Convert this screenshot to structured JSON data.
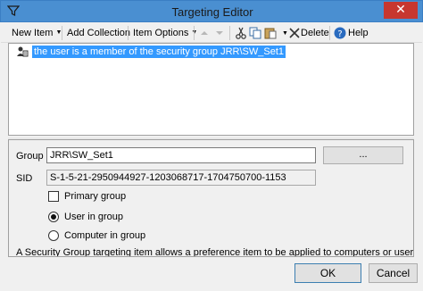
{
  "window": {
    "title": "Targeting Editor",
    "close_glyph": "✕",
    "icon": "filter-icon"
  },
  "toolbar": {
    "new_item": "New Item",
    "add_collection": "Add Collection",
    "item_options": "Item Options",
    "delete": "Delete",
    "help": "Help",
    "dropdown_glyph": "▼",
    "icons": [
      "move-up-icon",
      "move-down-icon",
      "cut-icon",
      "copy-icon",
      "paste-icon",
      "delete-icon",
      "help-icon"
    ]
  },
  "tree": {
    "items": [
      {
        "label": "the user is a member of the security group JRR\\SW_Set1",
        "selected": true,
        "icon": "security-group-icon"
      }
    ]
  },
  "properties": {
    "group_label": "Group",
    "group_value": "JRR\\SW_Set1",
    "browse_label": "...",
    "sid_label": "SID",
    "sid_value": "S-1-5-21-2950944927-1203068717-1704750700-1153",
    "primary_group_label": "Primary group",
    "primary_group_checked": false,
    "user_in_group_label": "User in group",
    "computer_in_group_label": "Computer in group",
    "selected_option": "User in group",
    "description": "A Security Group targeting item allows a preference item to be applied to computers or users only if"
  },
  "buttons": {
    "ok": "OK",
    "cancel": "Cancel"
  },
  "colors": {
    "titlebar": "#4a8fd1",
    "close": "#c7372f",
    "selection": "#3399ff"
  }
}
